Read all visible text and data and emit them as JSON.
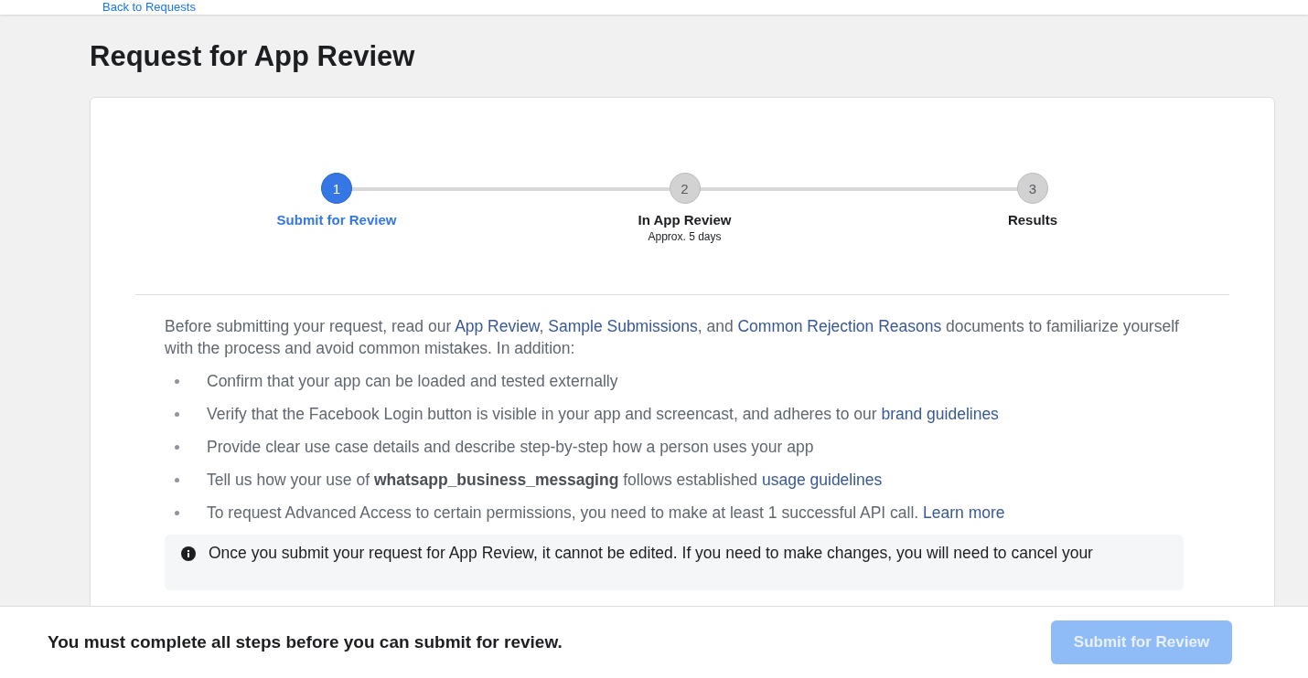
{
  "back_link": "Back to Requests",
  "title": "Request for App Review",
  "steps": [
    {
      "number": "1",
      "label": "Submit for Review",
      "selected": true
    },
    {
      "number": "2",
      "label": "In App Review",
      "sublabel": "Approx. 5 days",
      "selected": false
    },
    {
      "number": "3",
      "label": "Results",
      "selected": false
    }
  ],
  "intro": [
    {
      "text": "Before submitting your request, read our "
    },
    {
      "link": "App Review"
    },
    {
      "text": ", "
    },
    {
      "link": "Sample Submissions"
    },
    {
      "text": ", and "
    },
    {
      "link": "Common Rejection Reasons"
    },
    {
      "text": " documents to familiarize yourself with the process and avoid common mistakes. In addition:"
    }
  ],
  "checklist": [
    {
      "text": "Confirm that your app can be loaded and tested externally"
    },
    {
      "text": "Verify that the Facebook Login button is visible in your app and screencast, and adheres to our",
      "link": "brand guidelines"
    },
    {
      "text": "Provide clear use case details and describe step-by-step how a person uses your app"
    },
    {
      "text": "Tell us how your use of **whatsapp_business_messaging** follows established",
      "link": "usage guidelines"
    },
    {
      "text": "To request Advanced Access to certain permissions, you need to make at least 1 successful API call.",
      "link": "Learn more"
    }
  ],
  "notice": "Once you submit your request for App Review, it cannot be edited. If you need to make changes, you will need to cancel your",
  "footer": {
    "message": "You must complete all steps before you can submit for review.",
    "button": {
      "label": "Submit for Review",
      "disabled": true
    }
  }
}
